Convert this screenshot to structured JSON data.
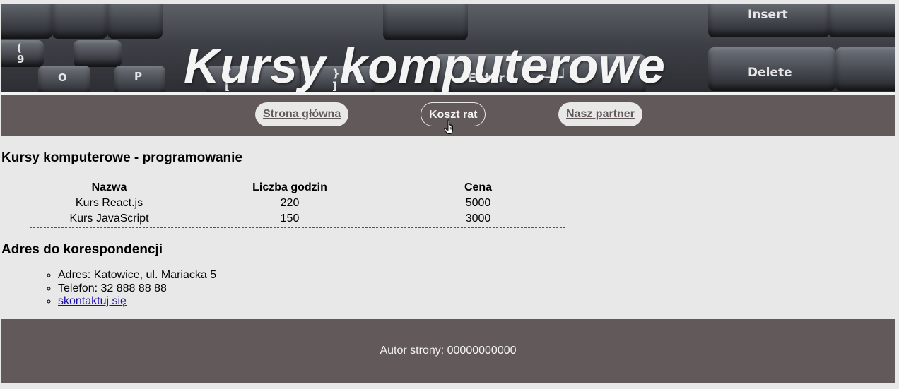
{
  "header": {
    "title": "Kursy komputerowe",
    "keys": [
      "(",
      "9",
      "O",
      "P",
      "{",
      "[",
      "}",
      "]",
      "Insert",
      "Enter",
      "Delete"
    ]
  },
  "nav": {
    "items": [
      {
        "label": "Strona główna",
        "active": false
      },
      {
        "label": "Koszt rat",
        "active": true
      },
      {
        "label": "Nasz partner",
        "active": false
      }
    ]
  },
  "courses": {
    "heading": "Kursy komputerowe - programowanie",
    "columns": [
      "Nazwa",
      "Liczba godzin",
      "Cena"
    ],
    "rows": [
      [
        "Kurs React.js",
        "220",
        "5000"
      ],
      [
        "Kurs JavaScript",
        "150",
        "3000"
      ]
    ]
  },
  "address": {
    "heading": "Adres do korespondencji",
    "items": [
      "Adres: Katowice, ul. Mariacka 5",
      "Telefon: 32 888 88 88"
    ],
    "link_label": "skontaktuj się"
  },
  "footer": {
    "text": "Autor strony: 00000000000"
  },
  "colors": {
    "background": "#e8e8e8",
    "bar": "#625a5a",
    "link": "#1a0dab"
  },
  "icons": [
    "hand-pointer-icon"
  ]
}
